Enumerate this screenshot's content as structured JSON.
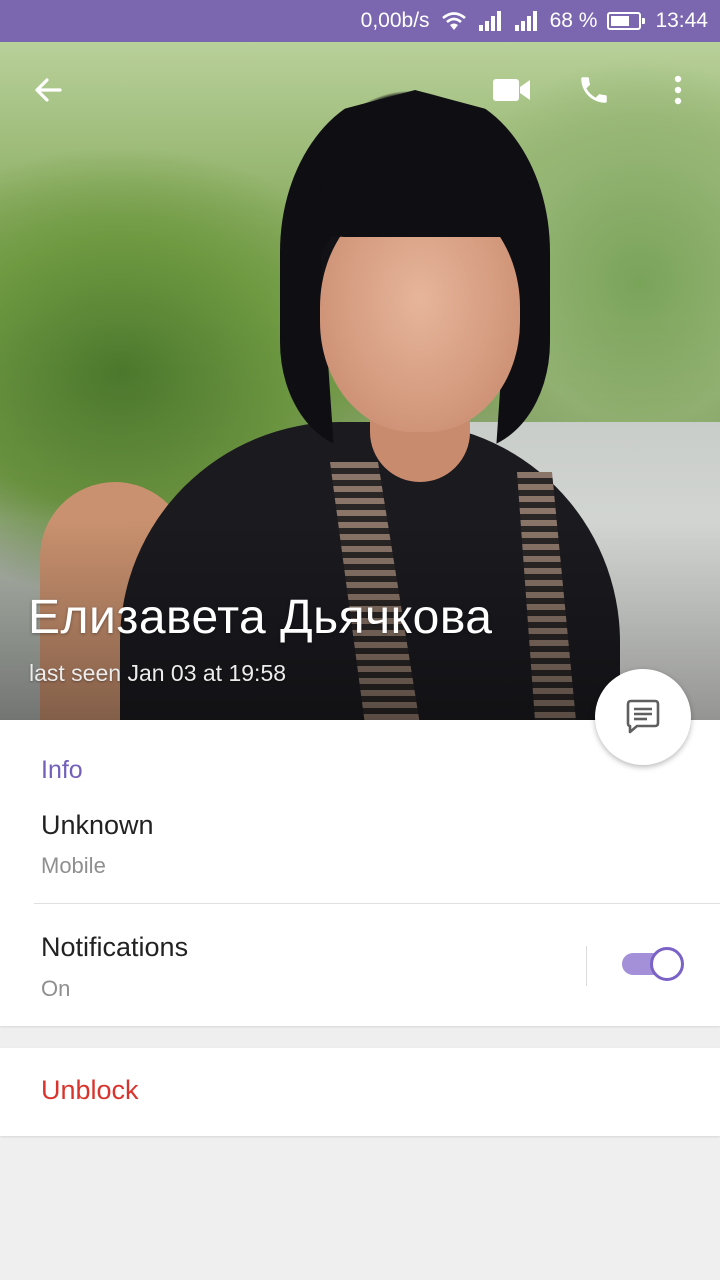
{
  "status_bar": {
    "network_speed": "0,00b/s",
    "battery_percent": "68 %",
    "battery_level": 0.68,
    "time": "13:44",
    "wifi_icon": "wifi-icon",
    "signal_icon": "signal-icon"
  },
  "toolbar": {
    "back_icon": "back-arrow-icon",
    "video_icon": "video-camera-icon",
    "call_icon": "phone-icon",
    "menu_icon": "more-vertical-icon"
  },
  "contact": {
    "name": "Елизавета Дьячкова",
    "last_seen": "last seen Jan 03 at 19:58"
  },
  "fab": {
    "icon": "message-icon"
  },
  "info": {
    "title": "Info",
    "phone_value": "Unknown",
    "phone_type": "Mobile"
  },
  "notifications": {
    "label": "Notifications",
    "state": "On",
    "enabled": true
  },
  "actions": {
    "unblock_label": "Unblock"
  },
  "colors": {
    "accent": "#7360b9",
    "status_bar": "#7b67b0",
    "danger": "#d8342d",
    "toggle_track": "#a48fd9"
  }
}
